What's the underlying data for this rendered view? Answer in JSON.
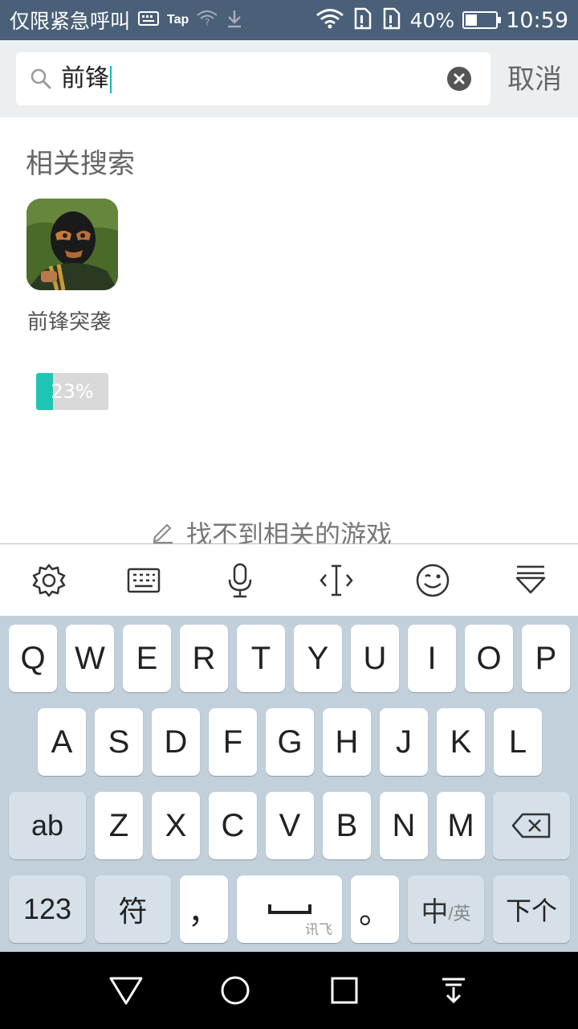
{
  "status_bar": {
    "left_text": "仅限紧急呼叫",
    "tap_label": "Tap",
    "battery_percent": "40%",
    "battery_level": 0.4,
    "time": "10:59"
  },
  "search": {
    "value": "前锋",
    "cancel_label": "取消"
  },
  "related": {
    "title": "相关搜索",
    "games": [
      {
        "name": "前锋突袭",
        "progress_label": "23%",
        "progress": 0.23
      }
    ]
  },
  "not_found_label": "找不到相关的游戏",
  "keyboard": {
    "row1": [
      "Q",
      "W",
      "E",
      "R",
      "T",
      "Y",
      "U",
      "I",
      "O",
      "P"
    ],
    "row2": [
      "A",
      "S",
      "D",
      "F",
      "G",
      "H",
      "J",
      "K",
      "L"
    ],
    "row3": [
      "ab",
      "Z",
      "X",
      "C",
      "V",
      "B",
      "N",
      "M"
    ],
    "row4": {
      "num": "123",
      "sym": "符",
      "comma": "，",
      "space_sub": "讯飞",
      "period": "。",
      "lang_main": "中",
      "lang_sub": "/英",
      "next": "下个"
    }
  },
  "colors": {
    "status_bar": "#4a5f78",
    "accent": "#1dc6b4",
    "keyboard_bg": "#c2d0dc"
  }
}
